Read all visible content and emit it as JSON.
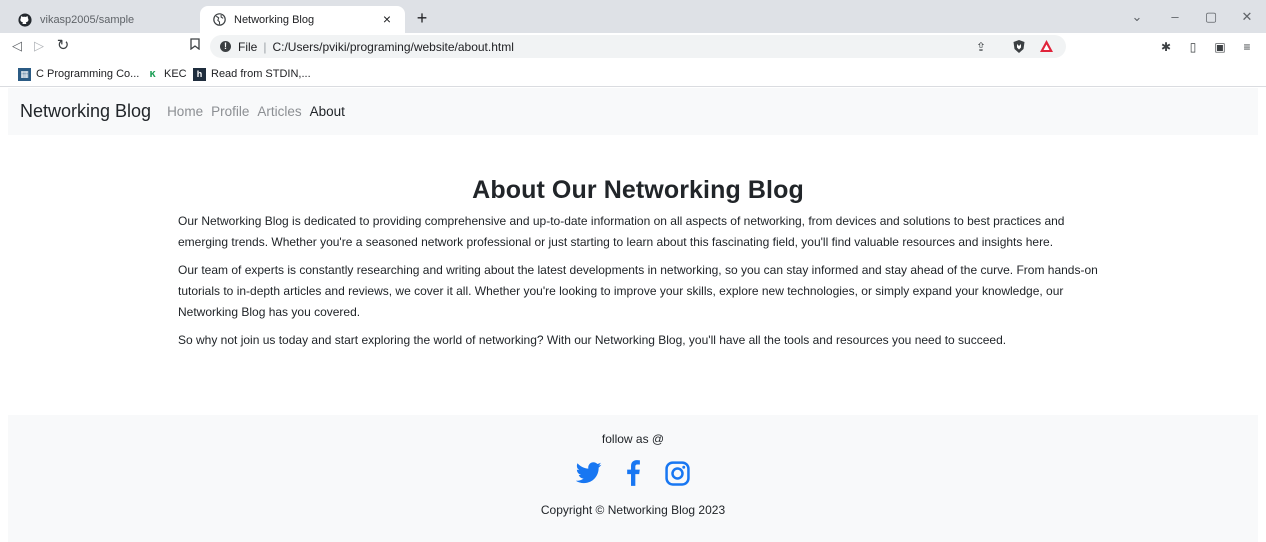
{
  "browser": {
    "tabs": [
      {
        "title": "vikasp2005/sample",
        "active": false
      },
      {
        "title": "Networking Blog",
        "active": true
      }
    ],
    "new_tab_label": "+",
    "close_label": "×",
    "address": {
      "scheme_label": "File",
      "separator": "|",
      "url": "C:/Users/pviki/programing/website/about.html"
    },
    "bookmarks": [
      {
        "label": "C Programming Co..."
      },
      {
        "label": "KEC"
      },
      {
        "label": "Read from STDIN,..."
      }
    ]
  },
  "site": {
    "brand": "Networking Blog",
    "nav": [
      {
        "label": "Home",
        "active": false
      },
      {
        "label": "Profile",
        "active": false
      },
      {
        "label": "Articles",
        "active": false
      },
      {
        "label": "About",
        "active": true
      }
    ],
    "heading": "About Our Networking Blog",
    "paragraphs": [
      "Our Networking Blog is dedicated to providing comprehensive and up-to-date information on all aspects of networking, from devices and solutions to best practices and emerging trends. Whether you're a seasoned network professional or just starting to learn about this fascinating field, you'll find valuable resources and insights here.",
      "Our team of experts is constantly researching and writing about the latest developments in networking, so you can stay informed and stay ahead of the curve. From hands-on tutorials to in-depth articles and reviews, we cover it all. Whether you're looking to improve your skills, explore new technologies, or simply expand your knowledge, our Networking Blog has you covered.",
      "So why not join us today and start exploring the world of networking? With our Networking Blog, you'll have all the tools and resources you need to succeed."
    ],
    "footer": {
      "follow_text": "follow as @",
      "socials": [
        "twitter-icon",
        "facebook-icon",
        "instagram-icon"
      ],
      "copyright": "Copyright © Networking Blog 2023"
    }
  },
  "colors": {
    "social_blue": "#1877f2",
    "nav_bg": "#f8f9fa"
  }
}
